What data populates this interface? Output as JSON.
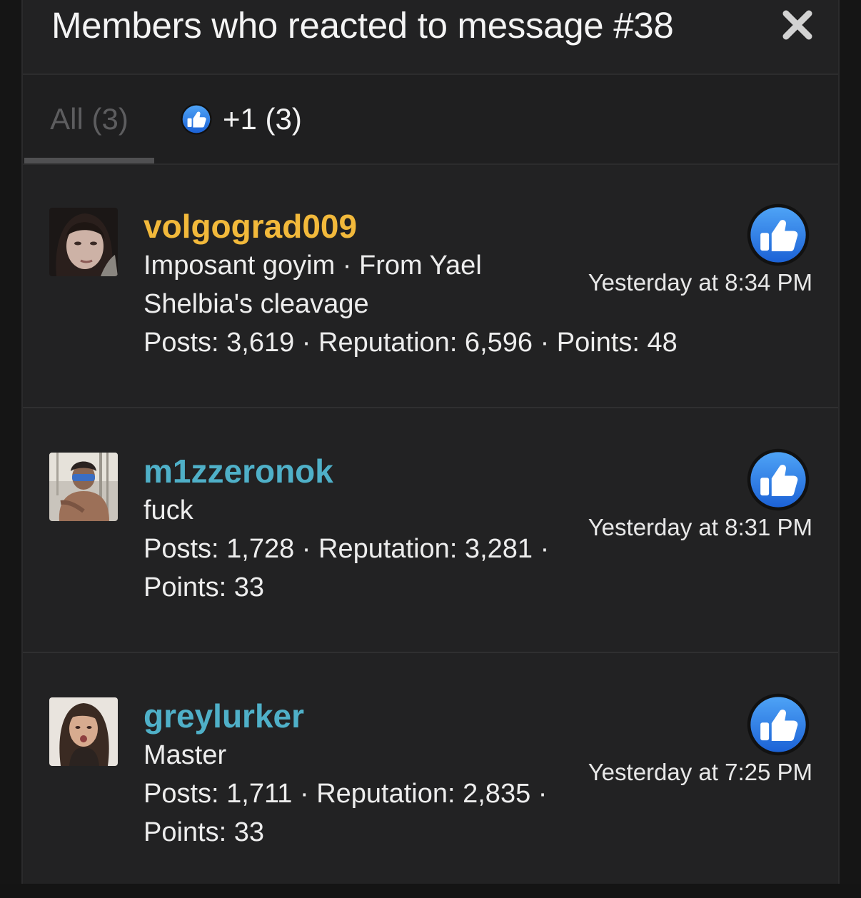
{
  "dialog": {
    "title": "Members who reacted to message #38"
  },
  "tabs": {
    "all_label": "All (3)",
    "like_label": "+1 (3)"
  },
  "colors": {
    "gold_user": "#f2b93b",
    "teal_user": "#4fb0c8",
    "like_blue": "#2f7fe8"
  },
  "members": [
    {
      "username": "volgograd009",
      "username_color": "#f2b93b",
      "title_lines": [
        "Imposant goyim · From Yael",
        "Shelbia's cleavage"
      ],
      "stats_lines": [
        "Posts: 3,619 · Reputation: 6,596 · Points: 48"
      ],
      "timestamp": "Yesterday at 8:34 PM",
      "reaction_icon": "thumbs-up-icon"
    },
    {
      "username": "m1zzeronok",
      "username_color": "#4fb0c8",
      "title_lines": [
        "fuck"
      ],
      "stats_lines": [
        "Posts: 1,728 · Reputation: 3,281 ·",
        "Points: 33"
      ],
      "timestamp": "Yesterday at 8:31 PM",
      "reaction_icon": "thumbs-up-icon"
    },
    {
      "username": "greylurker",
      "username_color": "#4fb0c8",
      "title_lines": [
        "Master"
      ],
      "stats_lines": [
        "Posts: 1,711 · Reputation: 2,835 ·",
        "Points: 33"
      ],
      "timestamp": "Yesterday at 7:25 PM",
      "reaction_icon": "thumbs-up-icon"
    }
  ]
}
